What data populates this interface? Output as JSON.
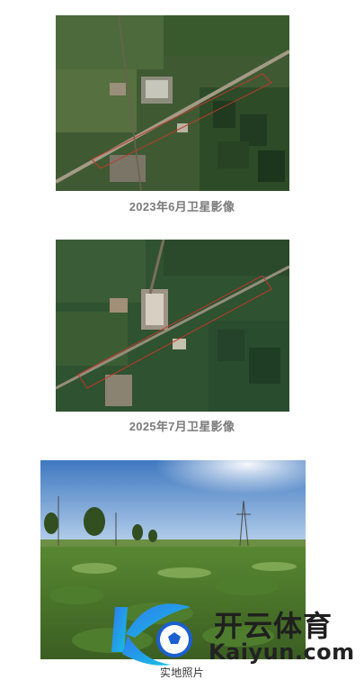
{
  "figures": [
    {
      "caption": "2023年6月卫星影像",
      "kind": "satellite image"
    },
    {
      "caption": "2025年7月卫星影像",
      "kind": "satellite image"
    },
    {
      "caption": "实地照片",
      "kind": "field photo"
    }
  ],
  "watermark": {
    "brand_cn": "开云体育",
    "brand_en": "Kaiyun.com",
    "logo_icon": "k-ball-logo-icon"
  },
  "colors": {
    "caption": "#7b7b7b",
    "boundary_line": "#c0392b"
  }
}
